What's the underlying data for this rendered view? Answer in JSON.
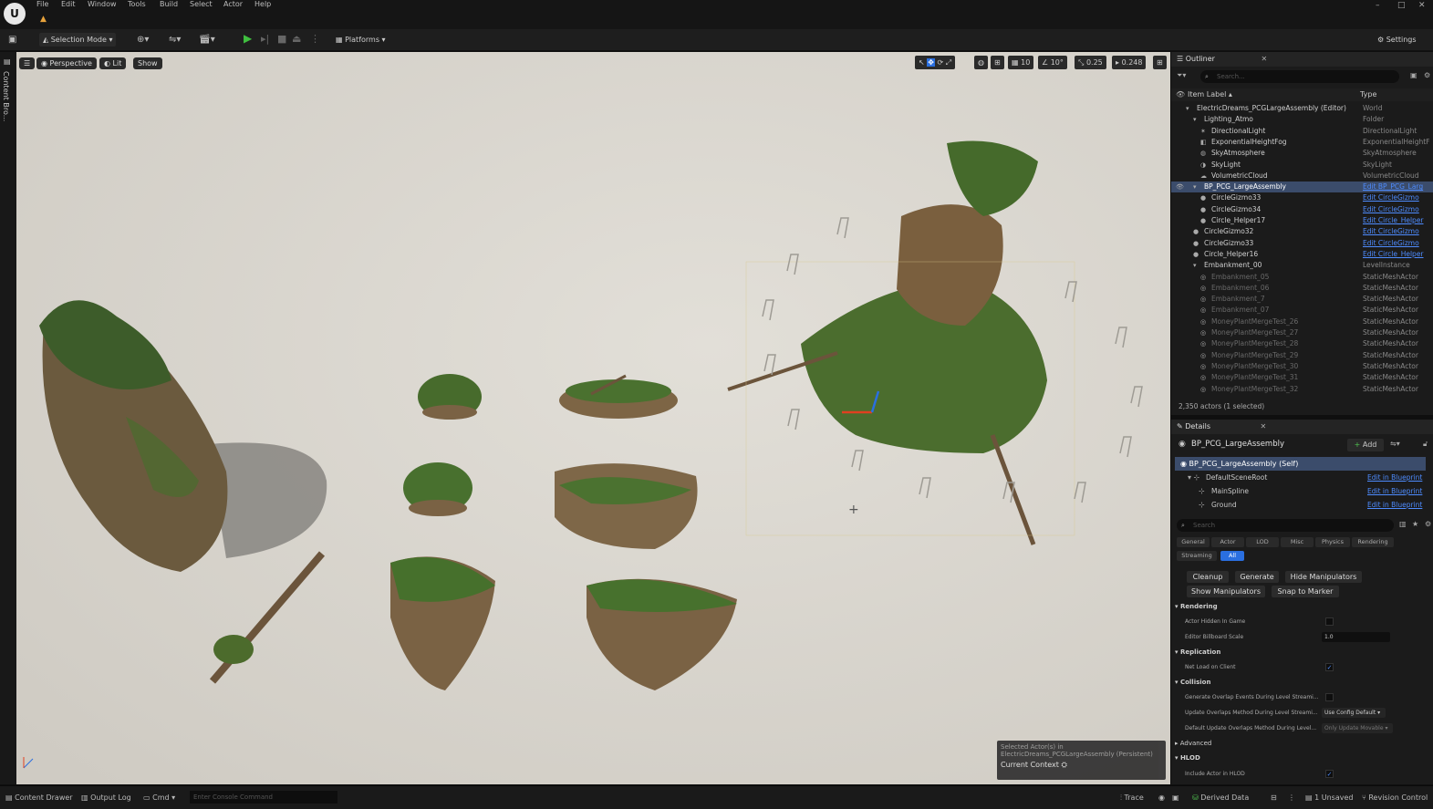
{
  "menu": [
    "File",
    "Edit",
    "Window",
    "Tools",
    "Build",
    "Select",
    "Actor",
    "Help"
  ],
  "toolbar": {
    "selection_mode": "Selection Mode",
    "platforms": "Platforms",
    "settings": "Settings"
  },
  "left_strip_label": "Content Bro...",
  "viewport": {
    "perspective": "Perspective",
    "lit": "Lit",
    "show": "Show",
    "grid_snap": "10",
    "angle_snap": "10°",
    "scale_snap": "0.25",
    "camera_speed": "0.248"
  },
  "context_box": {
    "line1": "Selected Actor(s) in",
    "line2": "ElectricDreams_PCGLargeAssembly (Persistent)",
    "current": "Current Context"
  },
  "outliner": {
    "title": "Outliner",
    "search_placeholder": "Search...",
    "col_label": "Item Label ▴",
    "col_type": "Type",
    "rows": [
      {
        "label": "ElectricDreams_PCGLargeAssembly (Editor)",
        "type": "World",
        "indent": 0,
        "icon": "▾",
        "kind": "normal"
      },
      {
        "label": "Lighting_Atmo",
        "type": "Folder",
        "indent": 1,
        "icon": "▾",
        "kind": "normal"
      },
      {
        "label": "DirectionalLight",
        "type": "DirectionalLight",
        "indent": 2,
        "icon": "✶",
        "kind": "normal"
      },
      {
        "label": "ExponentialHeightFog",
        "type": "ExponentialHeightF",
        "indent": 2,
        "icon": "◧",
        "kind": "normal"
      },
      {
        "label": "SkyAtmosphere",
        "type": "SkyAtmosphere",
        "indent": 2,
        "icon": "◍",
        "kind": "normal"
      },
      {
        "label": "SkyLight",
        "type": "SkyLight",
        "indent": 2,
        "icon": "◑",
        "kind": "normal"
      },
      {
        "label": "VolumetricCloud",
        "type": "VolumetricCloud",
        "indent": 2,
        "icon": "☁",
        "kind": "normal"
      },
      {
        "label": "BP_PCG_LargeAssembly",
        "type": "Edit BP_PCG_Larg",
        "indent": 1,
        "icon": "▾",
        "kind": "selected"
      },
      {
        "label": "CircleGizmo33",
        "type": "Edit CircleGizmo",
        "indent": 2,
        "icon": "●",
        "kind": "link"
      },
      {
        "label": "CircleGizmo34",
        "type": "Edit CircleGizmo",
        "indent": 2,
        "icon": "●",
        "kind": "link"
      },
      {
        "label": "Circle_Helper17",
        "type": "Edit Circle_Helper",
        "indent": 2,
        "icon": "●",
        "kind": "link"
      },
      {
        "label": "CircleGizmo32",
        "type": "Edit CircleGizmo",
        "indent": 1,
        "icon": "●",
        "kind": "link"
      },
      {
        "label": "CircleGizmo33",
        "type": "Edit CircleGizmo",
        "indent": 1,
        "icon": "●",
        "kind": "link"
      },
      {
        "label": "Circle_Helper16",
        "type": "Edit Circle_Helper",
        "indent": 1,
        "icon": "●",
        "kind": "link"
      },
      {
        "label": "Embankment_00",
        "type": "LevelInstance",
        "indent": 1,
        "icon": "▾",
        "kind": "normal"
      },
      {
        "label": "Embankment_05",
        "type": "StaticMeshActor",
        "indent": 2,
        "icon": "◎",
        "kind": "dim"
      },
      {
        "label": "Embankment_06",
        "type": "StaticMeshActor",
        "indent": 2,
        "icon": "◎",
        "kind": "dim"
      },
      {
        "label": "Embankment_7",
        "type": "StaticMeshActor",
        "indent": 2,
        "icon": "◎",
        "kind": "dim"
      },
      {
        "label": "Embankment_07",
        "type": "StaticMeshActor",
        "indent": 2,
        "icon": "◎",
        "kind": "dim"
      },
      {
        "label": "MoneyPlantMergeTest_26",
        "type": "StaticMeshActor",
        "indent": 2,
        "icon": "◎",
        "kind": "dim"
      },
      {
        "label": "MoneyPlantMergeTest_27",
        "type": "StaticMeshActor",
        "indent": 2,
        "icon": "◎",
        "kind": "dim"
      },
      {
        "label": "MoneyPlantMergeTest_28",
        "type": "StaticMeshActor",
        "indent": 2,
        "icon": "◎",
        "kind": "dim"
      },
      {
        "label": "MoneyPlantMergeTest_29",
        "type": "StaticMeshActor",
        "indent": 2,
        "icon": "◎",
        "kind": "dim"
      },
      {
        "label": "MoneyPlantMergeTest_30",
        "type": "StaticMeshActor",
        "indent": 2,
        "icon": "◎",
        "kind": "dim"
      },
      {
        "label": "MoneyPlantMergeTest_31",
        "type": "StaticMeshActor",
        "indent": 2,
        "icon": "◎",
        "kind": "dim"
      },
      {
        "label": "MoneyPlantMergeTest_32",
        "type": "StaticMeshActor",
        "indent": 2,
        "icon": "◎",
        "kind": "dim"
      }
    ],
    "actor_count": "2,350 actors (1 selected)"
  },
  "details": {
    "title": "Details",
    "actor_name": "BP_PCG_LargeAssembly",
    "add": "Add",
    "self_row": "BP_PCG_LargeAssembly (Self)",
    "components": [
      {
        "name": "DefaultSceneRoot",
        "action": "Edit in Blueprint"
      },
      {
        "name": "MainSpline",
        "action": "Edit in Blueprint"
      },
      {
        "name": "Ground",
        "action": "Edit in Blueprint"
      }
    ],
    "search_placeholder": "Search",
    "filters": [
      "General",
      "Actor",
      "LOD",
      "Misc",
      "Physics",
      "Rendering"
    ],
    "filters2": [
      "Streaming",
      "All"
    ],
    "buttons": [
      "Cleanup",
      "Generate",
      "Hide Manipulators",
      "Show Manipulators",
      "Snap to Marker"
    ],
    "sec_rendering": "Rendering",
    "actor_hidden": "Actor Hidden In Game",
    "billboard": "Editor Billboard Scale",
    "billboard_val": "1.0",
    "sec_replication": "Replication",
    "net_load": "Net Load on Client",
    "sec_collision": "Collision",
    "gen_overlap": "Generate Overlap Events During Level Streami...",
    "update_overlap": "Update Overlaps Method During Level Streami...",
    "update_overlap_val": "Use Config Default",
    "default_update": "Default Update Overlaps Method During Level...",
    "default_update_val": "Only Update Movable",
    "advanced": "Advanced",
    "sec_hlod": "HLOD",
    "include_hlod": "Include Actor in HLOD"
  },
  "status": {
    "content_drawer": "Content Drawer",
    "output_log": "Output Log",
    "cmd": "Cmd",
    "console_placeholder": "Enter Console Command",
    "trace": "Trace",
    "derived_data": "Derived Data",
    "unsaved": "1 Unsaved",
    "revision": "Revision Control"
  }
}
